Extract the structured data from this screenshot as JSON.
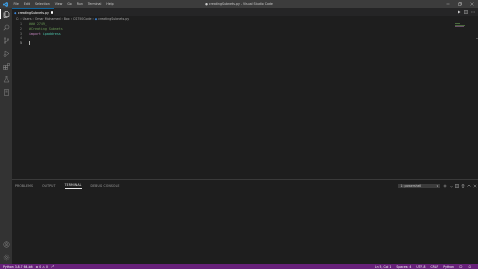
{
  "window": {
    "title": "● creatingSubnets.py - Visual Studio Code",
    "menu": [
      "File",
      "Edit",
      "Selection",
      "View",
      "Go",
      "Run",
      "Terminal",
      "Help"
    ]
  },
  "tab": {
    "label": "creatingSubnets.py",
    "icon": "python-file-icon",
    "dirty": true
  },
  "breadcrumb": {
    "path": [
      "C:",
      "Users",
      "Omar Mohamed",
      "Box",
      "CS750Code",
      "creatingSubnets.py"
    ],
    "file_icon": "python-file-icon"
  },
  "editor": {
    "lines": [
      {
        "num": "1",
        "text": "### 2749_",
        "class": "c-comment"
      },
      {
        "num": "2",
        "text": "#Creating Subnets",
        "class": "c-comment"
      },
      {
        "num": "3",
        "kw": "import",
        "mod": "ipaddress"
      },
      {
        "num": "4",
        "text": ""
      },
      {
        "num": "5",
        "text": ""
      }
    ]
  },
  "panel": {
    "tabs": [
      "PROBLEMS",
      "OUTPUT",
      "TERMINAL",
      "DEBUG CONSOLE"
    ],
    "active_tab": "TERMINAL",
    "terminal_selector": "1: powershell"
  },
  "statusbar": {
    "left": {
      "python": "Python 3.8.7 64-bit",
      "errors": "0",
      "warnings": "0"
    },
    "right": {
      "position": "Ln 5, Col 1",
      "spaces": "Spaces: 4",
      "encoding": "UTF-8",
      "eol": "CRLF",
      "language": "Python"
    }
  },
  "colors": {
    "titlebar": "#3c3c3c",
    "activitybar": "#333333",
    "editor_bg": "#1e1e1e",
    "statusbar": "#68217a",
    "comment": "#6a9955",
    "keyword": "#c586c0",
    "module": "#4ec9b0"
  }
}
